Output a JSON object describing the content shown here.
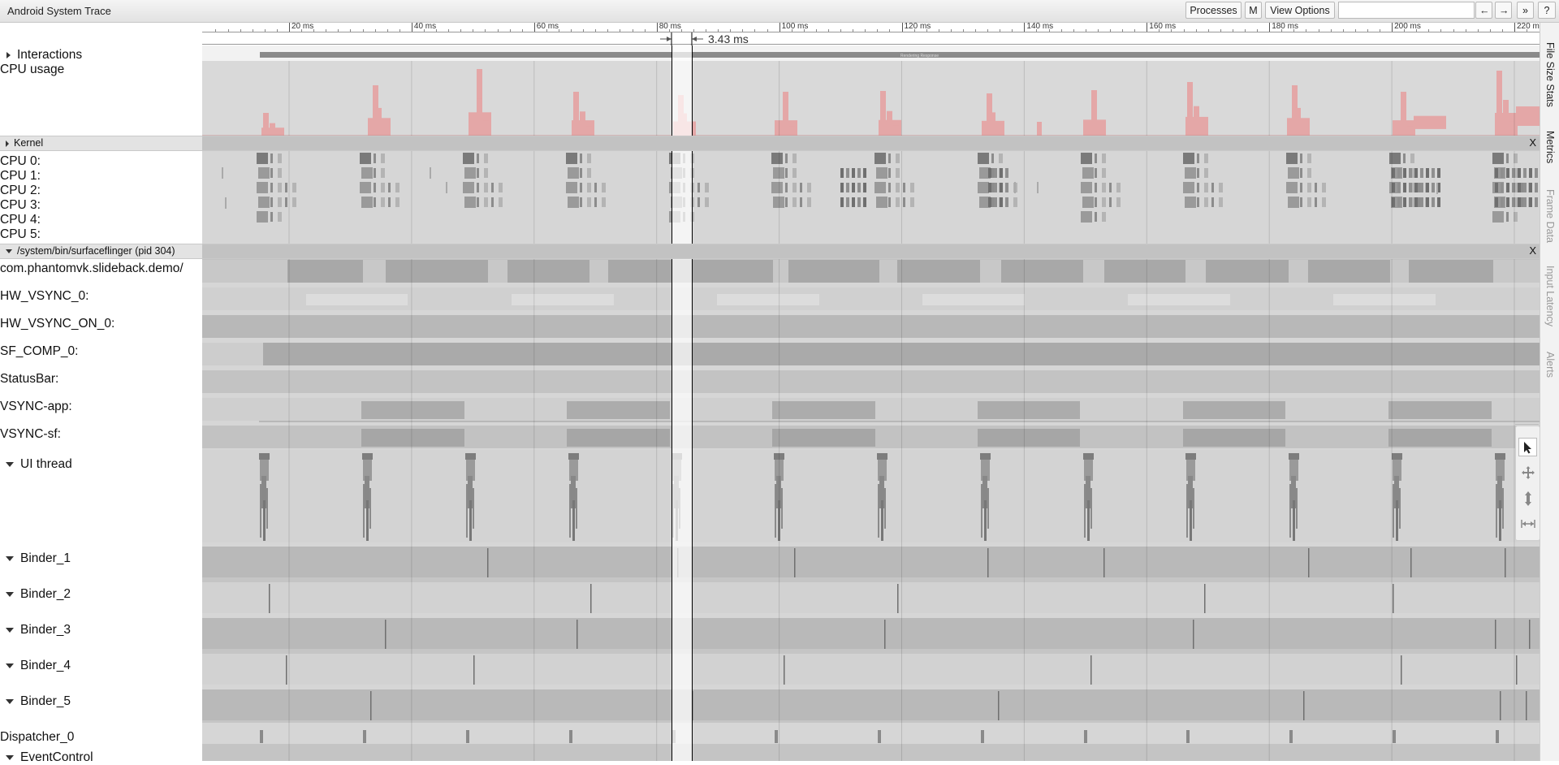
{
  "window": {
    "title": "Android System Trace"
  },
  "toolbar": {
    "processes_label": "Processes",
    "m_label": "M",
    "view_options_label": "View Options",
    "search_value": "",
    "prev_label": "←",
    "next_label": "→",
    "jump_label": "»",
    "help_label": "?"
  },
  "ruler": {
    "tick_labels": [
      "20 ms",
      "40 ms",
      "60 ms",
      "80 ms",
      "100 ms",
      "120 ms",
      "140 ms",
      "160 ms",
      "180 ms",
      "200 ms",
      "220 ms"
    ],
    "selection_duration": "3.43 ms"
  },
  "interactions": {
    "label": "Interactions",
    "slice_label": "Rendering Response"
  },
  "cpu_usage": {
    "label": "CPU usage"
  },
  "kernel": {
    "label": "Kernel",
    "close": "X",
    "cpus": [
      "CPU 0:",
      "CPU 1:",
      "CPU 2:",
      "CPU 3:",
      "CPU 4:",
      "CPU 5:"
    ]
  },
  "process": {
    "label": "/system/bin/surfaceflinger (pid 304)",
    "close": "X",
    "tracks": [
      "com.phantomvk.slideback.demo/",
      "HW_VSYNC_0:",
      "HW_VSYNC_ON_0:",
      "SF_COMP_0:",
      "StatusBar:",
      "VSYNC-app:",
      "VSYNC-sf:"
    ],
    "threads": [
      "UI thread",
      "Binder_1",
      "Binder_2",
      "Binder_3",
      "Binder_4",
      "Binder_5"
    ],
    "dispatcher": "Dispatcher_0",
    "event_control": "EventControl"
  },
  "side_tabs": [
    "File Size Stats",
    "Metrics",
    "Frame Data",
    "Input Latency",
    "Alerts"
  ],
  "tools": [
    "selection-tool",
    "pan-tool",
    "zoom-tool",
    "timing-tool"
  ],
  "colors": {
    "cpu_usage": "#e4a7a7",
    "selection_band": "#ffffff",
    "track_bg": "#d6d6d6"
  }
}
